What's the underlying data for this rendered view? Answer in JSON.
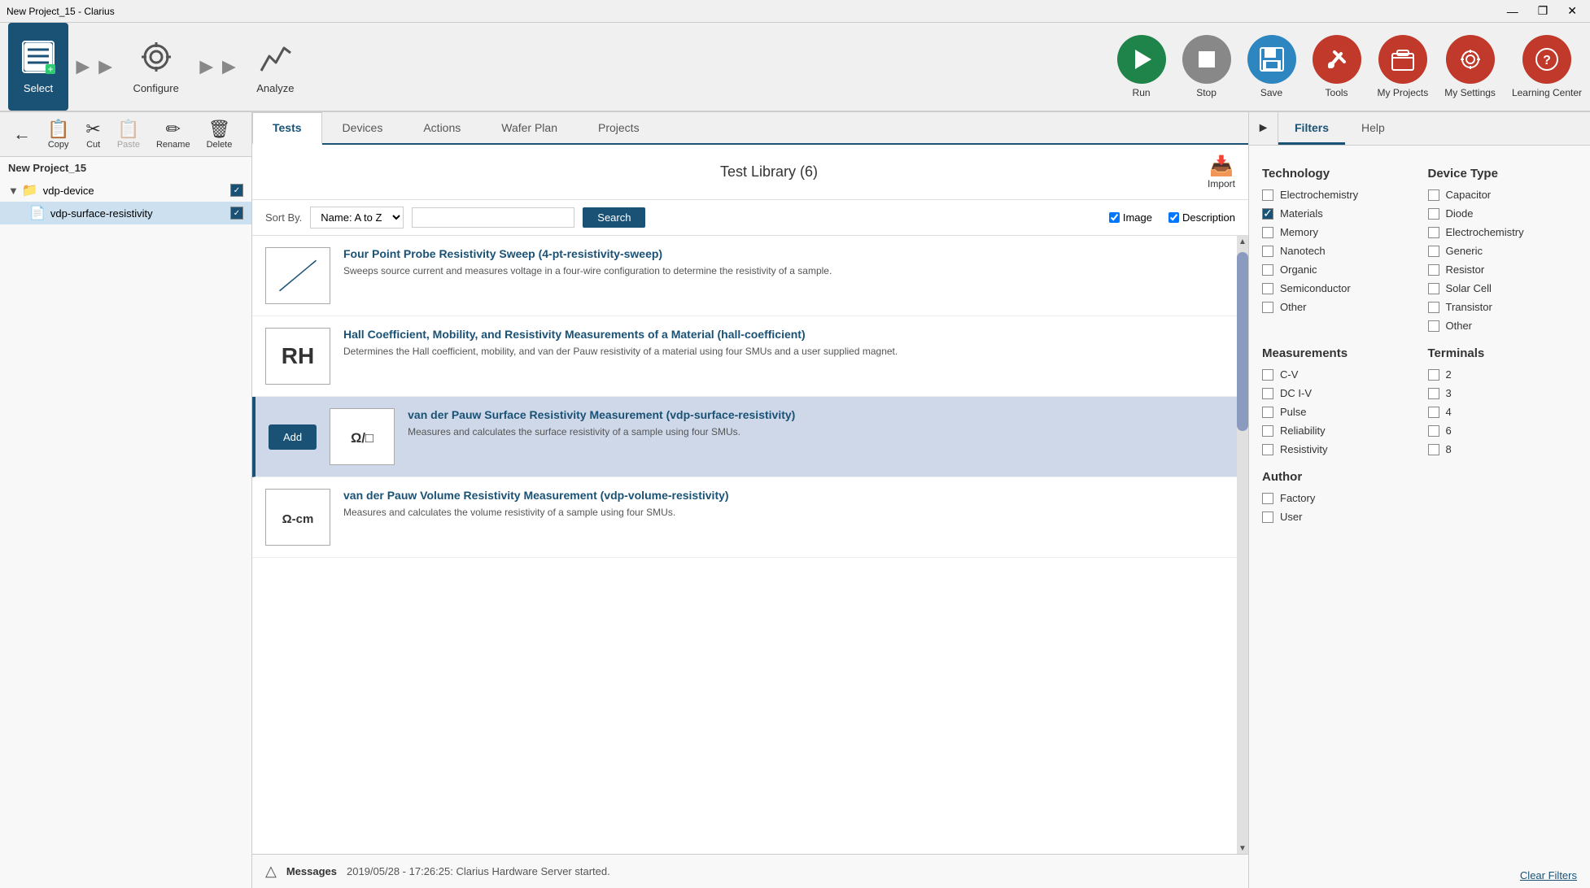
{
  "window": {
    "title": "New Project_15 - Clarius"
  },
  "titlebar": {
    "controls": [
      "—",
      "❐",
      "✕"
    ]
  },
  "toolbar": {
    "select_label": "Select",
    "configure_label": "Configure",
    "analyze_label": "Analyze",
    "run_label": "Run",
    "stop_label": "Stop",
    "save_label": "Save",
    "tools_label": "Tools",
    "myprojects_label": "My Projects",
    "mysettings_label": "My Settings",
    "learningcenter_label": "Learning Center"
  },
  "left_toolbar": {
    "copy_label": "Copy",
    "cut_label": "Cut",
    "paste_label": "Paste",
    "rename_label": "Rename",
    "delete_label": "Delete"
  },
  "project": {
    "name": "New Project_15",
    "devices": [
      {
        "name": "vdp-device",
        "children": [
          {
            "name": "vdp-surface-resistivity"
          }
        ]
      }
    ]
  },
  "tabs": {
    "items": [
      "Tests",
      "Devices",
      "Actions",
      "Wafer Plan",
      "Projects"
    ],
    "active": "Tests"
  },
  "library": {
    "title": "Test Library (6)",
    "import_label": "Import",
    "sort_label": "Sort By.",
    "sort_value": "Name: A to Z",
    "search_placeholder": "",
    "search_btn": "Search",
    "image_label": "Image",
    "description_label": "Description"
  },
  "tests": [
    {
      "id": "four-point",
      "name": "Four Point Probe Resistivity Sweep (4-pt-resistivity-sweep)",
      "desc": "Sweeps source current and measures voltage in a four-wire configuration to determine the resistivity of a sample.",
      "icon_type": "svg_line",
      "selected": false
    },
    {
      "id": "hall-coefficient",
      "name": "Hall Coefficient, Mobility, and Resistivity Measurements of a Material (hall-coefficient)",
      "desc": "Determines the Hall coefficient, mobility, and van der Pauw resistivity of a material using four SMUs and a user supplied magnet.",
      "icon_type": "text_rh",
      "selected": false
    },
    {
      "id": "vdp-surface-resistivity",
      "name": "van der Pauw Surface Resistivity Measurement (vdp-surface-resistivity)",
      "desc": "Measures and calculates the surface resistivity of a sample using four SMUs.",
      "icon_type": "text_omega_square",
      "selected": true
    },
    {
      "id": "vdp-volume-resistivity",
      "name": "van der Pauw Volume Resistivity Measurement (vdp-volume-resistivity)",
      "desc": "Measures and calculates the volume resistivity of a sample using four SMUs.",
      "icon_type": "text_omega_cm",
      "selected": false
    }
  ],
  "messages": {
    "label": "Messages",
    "text": "2019/05/28 - 17:26:25: Clarius Hardware Server started."
  },
  "filters": {
    "tabs": [
      "Filters",
      "Help"
    ],
    "active_tab": "Filters",
    "technology": {
      "title": "Technology",
      "items": [
        {
          "label": "Electrochemistry",
          "checked": false
        },
        {
          "label": "Materials",
          "checked": true
        },
        {
          "label": "Memory",
          "checked": false
        },
        {
          "label": "Nanotech",
          "checked": false
        },
        {
          "label": "Organic",
          "checked": false
        },
        {
          "label": "Semiconductor",
          "checked": false
        },
        {
          "label": "Other",
          "checked": false
        }
      ]
    },
    "device_type": {
      "title": "Device Type",
      "items": [
        {
          "label": "Capacitor",
          "checked": false
        },
        {
          "label": "Diode",
          "checked": false
        },
        {
          "label": "Electrochemistry",
          "checked": false
        },
        {
          "label": "Generic",
          "checked": false
        },
        {
          "label": "Resistor",
          "checked": false
        },
        {
          "label": "Solar Cell",
          "checked": false
        },
        {
          "label": "Transistor",
          "checked": false
        },
        {
          "label": "Other",
          "checked": false
        }
      ]
    },
    "measurements": {
      "title": "Measurements",
      "items": [
        {
          "label": "C-V",
          "checked": false
        },
        {
          "label": "DC I-V",
          "checked": false
        },
        {
          "label": "Pulse",
          "checked": false
        },
        {
          "label": "Reliability",
          "checked": false
        },
        {
          "label": "Resistivity",
          "checked": false
        }
      ]
    },
    "terminals": {
      "title": "Terminals",
      "items": [
        {
          "label": "2",
          "checked": false
        },
        {
          "label": "3",
          "checked": false
        },
        {
          "label": "4",
          "checked": false
        },
        {
          "label": "6",
          "checked": false
        },
        {
          "label": "8",
          "checked": false
        }
      ]
    },
    "author": {
      "title": "Author",
      "items": [
        {
          "label": "Factory",
          "checked": false
        },
        {
          "label": "User",
          "checked": false
        }
      ]
    },
    "clear_label": "Clear Filters"
  }
}
